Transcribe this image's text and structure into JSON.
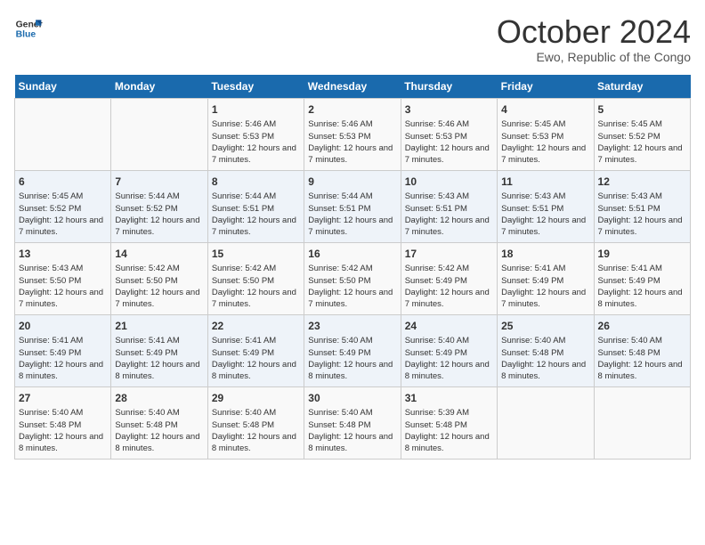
{
  "logo": {
    "line1": "General",
    "line2": "Blue"
  },
  "title": "October 2024",
  "subtitle": "Ewo, Republic of the Congo",
  "headers": [
    "Sunday",
    "Monday",
    "Tuesday",
    "Wednesday",
    "Thursday",
    "Friday",
    "Saturday"
  ],
  "weeks": [
    [
      {
        "day": "",
        "info": ""
      },
      {
        "day": "",
        "info": ""
      },
      {
        "day": "1",
        "info": "Sunrise: 5:46 AM\nSunset: 5:53 PM\nDaylight: 12 hours and 7 minutes."
      },
      {
        "day": "2",
        "info": "Sunrise: 5:46 AM\nSunset: 5:53 PM\nDaylight: 12 hours and 7 minutes."
      },
      {
        "day": "3",
        "info": "Sunrise: 5:46 AM\nSunset: 5:53 PM\nDaylight: 12 hours and 7 minutes."
      },
      {
        "day": "4",
        "info": "Sunrise: 5:45 AM\nSunset: 5:53 PM\nDaylight: 12 hours and 7 minutes."
      },
      {
        "day": "5",
        "info": "Sunrise: 5:45 AM\nSunset: 5:52 PM\nDaylight: 12 hours and 7 minutes."
      }
    ],
    [
      {
        "day": "6",
        "info": "Sunrise: 5:45 AM\nSunset: 5:52 PM\nDaylight: 12 hours and 7 minutes."
      },
      {
        "day": "7",
        "info": "Sunrise: 5:44 AM\nSunset: 5:52 PM\nDaylight: 12 hours and 7 minutes."
      },
      {
        "day": "8",
        "info": "Sunrise: 5:44 AM\nSunset: 5:51 PM\nDaylight: 12 hours and 7 minutes."
      },
      {
        "day": "9",
        "info": "Sunrise: 5:44 AM\nSunset: 5:51 PM\nDaylight: 12 hours and 7 minutes."
      },
      {
        "day": "10",
        "info": "Sunrise: 5:43 AM\nSunset: 5:51 PM\nDaylight: 12 hours and 7 minutes."
      },
      {
        "day": "11",
        "info": "Sunrise: 5:43 AM\nSunset: 5:51 PM\nDaylight: 12 hours and 7 minutes."
      },
      {
        "day": "12",
        "info": "Sunrise: 5:43 AM\nSunset: 5:51 PM\nDaylight: 12 hours and 7 minutes."
      }
    ],
    [
      {
        "day": "13",
        "info": "Sunrise: 5:43 AM\nSunset: 5:50 PM\nDaylight: 12 hours and 7 minutes."
      },
      {
        "day": "14",
        "info": "Sunrise: 5:42 AM\nSunset: 5:50 PM\nDaylight: 12 hours and 7 minutes."
      },
      {
        "day": "15",
        "info": "Sunrise: 5:42 AM\nSunset: 5:50 PM\nDaylight: 12 hours and 7 minutes."
      },
      {
        "day": "16",
        "info": "Sunrise: 5:42 AM\nSunset: 5:50 PM\nDaylight: 12 hours and 7 minutes."
      },
      {
        "day": "17",
        "info": "Sunrise: 5:42 AM\nSunset: 5:49 PM\nDaylight: 12 hours and 7 minutes."
      },
      {
        "day": "18",
        "info": "Sunrise: 5:41 AM\nSunset: 5:49 PM\nDaylight: 12 hours and 7 minutes."
      },
      {
        "day": "19",
        "info": "Sunrise: 5:41 AM\nSunset: 5:49 PM\nDaylight: 12 hours and 8 minutes."
      }
    ],
    [
      {
        "day": "20",
        "info": "Sunrise: 5:41 AM\nSunset: 5:49 PM\nDaylight: 12 hours and 8 minutes."
      },
      {
        "day": "21",
        "info": "Sunrise: 5:41 AM\nSunset: 5:49 PM\nDaylight: 12 hours and 8 minutes."
      },
      {
        "day": "22",
        "info": "Sunrise: 5:41 AM\nSunset: 5:49 PM\nDaylight: 12 hours and 8 minutes."
      },
      {
        "day": "23",
        "info": "Sunrise: 5:40 AM\nSunset: 5:49 PM\nDaylight: 12 hours and 8 minutes."
      },
      {
        "day": "24",
        "info": "Sunrise: 5:40 AM\nSunset: 5:49 PM\nDaylight: 12 hours and 8 minutes."
      },
      {
        "day": "25",
        "info": "Sunrise: 5:40 AM\nSunset: 5:48 PM\nDaylight: 12 hours and 8 minutes."
      },
      {
        "day": "26",
        "info": "Sunrise: 5:40 AM\nSunset: 5:48 PM\nDaylight: 12 hours and 8 minutes."
      }
    ],
    [
      {
        "day": "27",
        "info": "Sunrise: 5:40 AM\nSunset: 5:48 PM\nDaylight: 12 hours and 8 minutes."
      },
      {
        "day": "28",
        "info": "Sunrise: 5:40 AM\nSunset: 5:48 PM\nDaylight: 12 hours and 8 minutes."
      },
      {
        "day": "29",
        "info": "Sunrise: 5:40 AM\nSunset: 5:48 PM\nDaylight: 12 hours and 8 minutes."
      },
      {
        "day": "30",
        "info": "Sunrise: 5:40 AM\nSunset: 5:48 PM\nDaylight: 12 hours and 8 minutes."
      },
      {
        "day": "31",
        "info": "Sunrise: 5:39 AM\nSunset: 5:48 PM\nDaylight: 12 hours and 8 minutes."
      },
      {
        "day": "",
        "info": ""
      },
      {
        "day": "",
        "info": ""
      }
    ]
  ]
}
